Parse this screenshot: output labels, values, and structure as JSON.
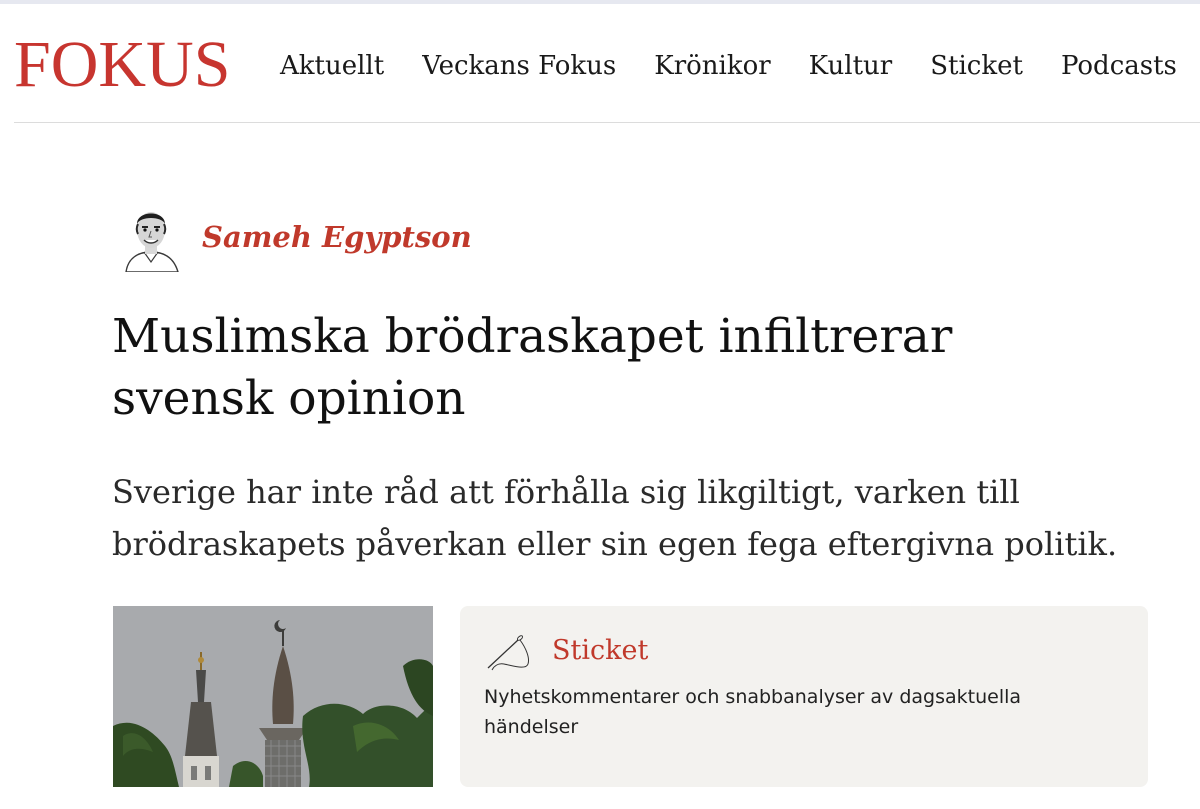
{
  "brand": {
    "logo_text": "FOKUS",
    "accent_color": "#c7352f"
  },
  "nav": {
    "items": [
      {
        "label": "Aktuellt"
      },
      {
        "label": "Veckans Fokus"
      },
      {
        "label": "Krönikor"
      },
      {
        "label": "Kultur"
      },
      {
        "label": "Sticket"
      },
      {
        "label": "Podcasts"
      }
    ]
  },
  "article": {
    "author": "Sameh Egyptson",
    "title": "Muslimska brödraskapet infiltrerar svensk opinion",
    "lead": "Sverige har inte råd att förhålla sig likgiltigt, varken till brödraskapets påverkan eller sin egen fega eftergivna politik."
  },
  "section_card": {
    "icon": "needle-thread-icon",
    "title": "Sticket",
    "description": "Nyhetskommentarer och snabbanalyser av dagsaktuella händelser"
  }
}
